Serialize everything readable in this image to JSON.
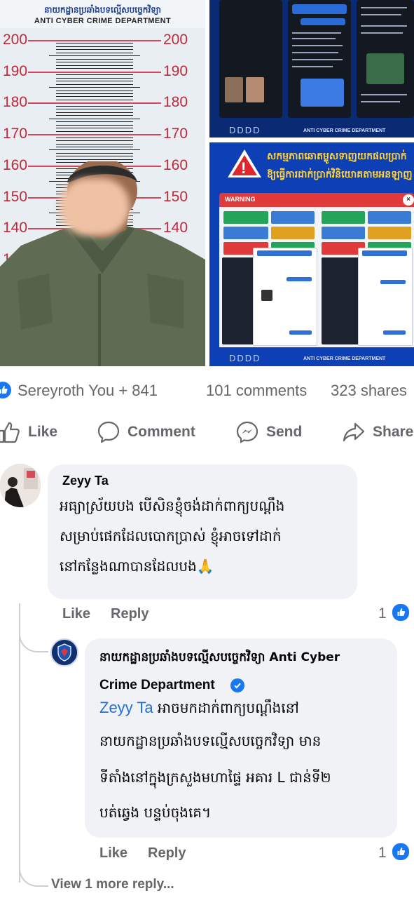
{
  "post_images": {
    "mugshot": {
      "header_kh": "នាយកដ្ឋានប្រឆាំងបទល្មើសបច្ចេកវិទ្យា",
      "header_en": "ANTI CYBER CRIME DEPARTMENT",
      "scale_labels": [
        "200",
        "190",
        "180",
        "170",
        "160",
        "150",
        "140",
        "130"
      ]
    },
    "warning_panel": {
      "headline_kh_line1": "សកម្មភាពឆោតម្លូសទាញយកផលប្រាក់",
      "headline_kh_line2": "ឱ្យធ្វើការដាក់ប្រាក់វិនិយោគតាមអនឡាញ",
      "warning_label": "WARNING",
      "close_glyph": "×",
      "footer_arrows": "DDDD",
      "footer_logo": "ANTI CYBER CRIME DEPARTMENT"
    },
    "top_panel": {
      "footer_arrows": "DDDD",
      "footer_logo": "ANTI CYBER CRIME DEPARTMENT"
    }
  },
  "reactions": {
    "names": "Sereyroth You + 841",
    "comments": "101 comments",
    "shares": "323 shares",
    "icon": "like-thumb-icon",
    "color": "#1877f2"
  },
  "actions": {
    "like": "Like",
    "comment": "Comment",
    "send": "Send",
    "share": "Share"
  },
  "comments": [
    {
      "author": "Zeyy Ta",
      "lines": [
        "អធ្យាស្រ័យបង បើសិនខ្ញុំចង់ដាក់ពាក្យបណ្ដឹង",
        "សម្រាប់ផេកដែលបោកប្រាស់ ខ្ញុំអាចទៅដាក់",
        "នៅកន្លែងណាបានដែលបង🙏"
      ],
      "like_label": "Like",
      "reply_label": "Reply",
      "like_count": "1"
    }
  ],
  "reply": {
    "author_kh": "នាយកដ្ឋានប្រឆាំងបទល្មើសបច្ចេកវិទ្យា Anti Cyber",
    "author_en": "Crime Department",
    "verified_icon": "verified-badge-icon",
    "mention": "Zeyy Ta",
    "line1": " អាចមកដាក់ពាក្យបណ្ដឹងនៅ",
    "line2": "នាយកដ្ឋានប្រឆាំងបទល្មើសបច្ចេកវិទ្យា មាន",
    "line3": "ទីតាំងនៅក្នុងក្រសួងមហាផ្ទៃ អគារ L ជាន់ទី២",
    "line4": "បត់ឆ្វេង បន្ទប់ចុងគេ។",
    "like_label": "Like",
    "reply_label": "Reply",
    "like_count": "1"
  },
  "view_more": "View 1 more reply..."
}
